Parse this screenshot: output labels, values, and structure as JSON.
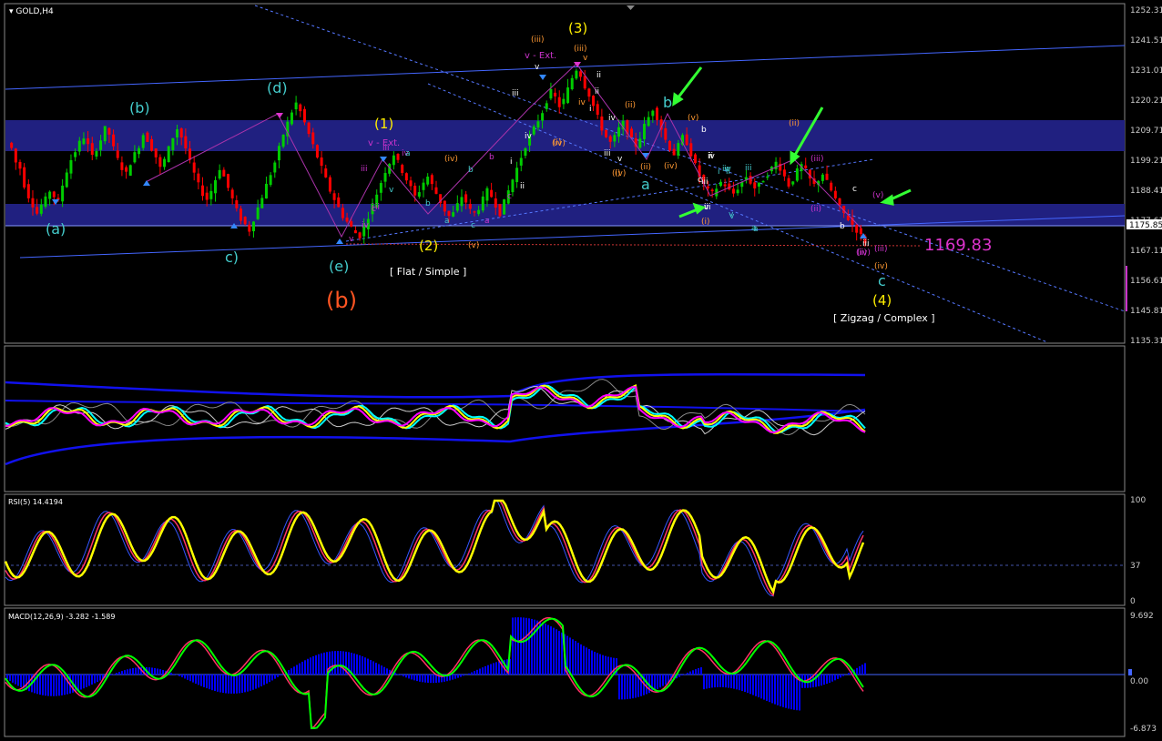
{
  "window": {
    "title": "GOLD,H4"
  },
  "price_panel": {
    "scale_labels": [
      "1252.31",
      "1241.51",
      "1231.01",
      "1220.21",
      "1209.71",
      "1199.21",
      "1188.41",
      "1177.61",
      "1167.11",
      "1156.61",
      "1145.81",
      "1135.31"
    ],
    "current_price": "1175.85",
    "target_price": "1169.83",
    "pattern_labels": [
      "[ Flat / Simple ]",
      "[ Zigzag / Complex ]"
    ],
    "wave_labels": {
      "a_b_c_d_e": [
        "(a)",
        "(b)",
        "c)",
        "(d)",
        "(e)"
      ],
      "big_b": "(b)",
      "yellow": [
        "(1)",
        "(2)",
        "(3)",
        "(4)"
      ],
      "cyan_abc": [
        "a",
        "b",
        "c"
      ],
      "ext": [
        "v - Ext.",
        "v - Ext."
      ],
      "small": [
        "iii",
        "iv",
        "v",
        "i",
        "ii",
        "iii",
        "iv",
        "v",
        "a",
        "b",
        "c",
        "a",
        "b",
        "c",
        "i",
        "ii",
        "iii",
        "iv",
        "v",
        "a",
        "b",
        "c",
        "ii",
        "iii",
        "iv",
        "v",
        "i",
        "ii",
        "iii",
        "iv",
        "v",
        "i",
        "ii",
        "iii",
        "iv",
        "v",
        "a",
        "b",
        "c",
        "iii",
        "iv",
        "v",
        "a",
        "b",
        "c",
        "ii",
        "iii",
        "iv",
        "v",
        "(i)",
        "(ii)",
        "(iii)",
        "(iv)",
        "(v)",
        "(i)",
        "(ii)",
        "(iii)",
        "(iv)",
        "(v)",
        "(i)",
        "(ii)",
        "(iii)",
        "(iv)",
        "(v)",
        "(ii)",
        "(iv)",
        "(ii)",
        "(iii)",
        "(iv)",
        "(v)"
      ]
    }
  },
  "bands_panel": {},
  "rsi_panel": {
    "title": "RSI(5) 14.4194",
    "scale_labels": [
      "100",
      "37",
      "0"
    ]
  },
  "macd_panel": {
    "title": "MACD(12,26,9) -3.282 -1.589",
    "scale_labels": [
      "9.692",
      "0.00",
      "-6.873"
    ]
  },
  "colors": {
    "background": "#000000",
    "bull_candle": "#00cc00",
    "bear_candle": "#ff0000",
    "zone": "#202080",
    "trendline": "#4466ff",
    "target_line": "#cc3333",
    "wave_yellow": "#ffee00",
    "wave_cyan": "#44cccc",
    "wave_orange": "#ff5522",
    "wave_magenta": "#cc33cc",
    "arrow_green": "#33ff33",
    "rsi_line": "#ffff00",
    "macd_line": "#00ff00",
    "macd_hist": "#0000ff"
  },
  "chart_data": [
    {
      "type": "candlestick",
      "title": "GOLD,H4",
      "ylim": [
        1135.31,
        1252.31
      ],
      "close_path": [
        1205,
        1203,
        1198,
        1196,
        1190,
        1186,
        1183,
        1180,
        1183,
        1185,
        1188,
        1186,
        1184,
        1190,
        1195,
        1199,
        1202,
        1205,
        1207,
        1204,
        1200,
        1203,
        1206,
        1210,
        1208,
        1203,
        1199,
        1196,
        1194,
        1198,
        1201,
        1204,
        1208,
        1206,
        1203,
        1200,
        1196,
        1199,
        1203,
        1207,
        1210,
        1207,
        1203,
        1198,
        1194,
        1190,
        1187,
        1185,
        1188,
        1192,
        1196,
        1193,
        1189,
        1185,
        1181,
        1178,
        1176,
        1174,
        1178,
        1182,
        1186,
        1190,
        1194,
        1198,
        1203,
        1208,
        1212,
        1216,
        1219,
        1216,
        1212,
        1208,
        1204,
        1200,
        1196,
        1192,
        1188,
        1185,
        1182,
        1179,
        1177,
        1175,
        1173,
        1172,
        1175,
        1179,
        1183,
        1187,
        1191,
        1195,
        1198,
        1201,
        1198,
        1195,
        1192,
        1189,
        1186,
        1188,
        1191,
        1193,
        1190,
        1187,
        1184,
        1181,
        1179,
        1180,
        1183,
        1186,
        1184,
        1181,
        1180,
        1182,
        1185,
        1188,
        1186,
        1183,
        1180,
        1184,
        1188,
        1192,
        1196,
        1200,
        1204,
        1207,
        1210,
        1213,
        1216,
        1220,
        1223,
        1221,
        1218,
        1220,
        1224,
        1228,
        1231,
        1229,
        1225,
        1222,
        1218,
        1214,
        1210,
        1207,
        1205,
        1207,
        1210,
        1212,
        1209,
        1206,
        1204,
        1207,
        1211,
        1214,
        1217,
        1214,
        1210,
        1206,
        1203,
        1201,
        1204,
        1207,
        1205,
        1201,
        1197,
        1193,
        1190,
        1188,
        1187,
        1189,
        1191,
        1190,
        1188,
        1187,
        1189,
        1191,
        1193,
        1191,
        1189,
        1190,
        1192,
        1194,
        1196,
        1198,
        1196,
        1193,
        1190,
        1192,
        1195,
        1197,
        1195,
        1192,
        1190,
        1192,
        1194,
        1191,
        1188,
        1185,
        1182,
        1180,
        1178,
        1176,
        1174,
        1172,
        1170
      ]
    },
    {
      "type": "line",
      "title": "RSI(5) 14.4194",
      "ylim": [
        0,
        100
      ],
      "levels": [
        37
      ],
      "series": [
        {
          "name": "RSI(5)",
          "current": 14.4194
        }
      ]
    },
    {
      "type": "bar",
      "title": "MACD(12,26,9) -3.282 -1.589",
      "ylim": [
        -6.873,
        9.692
      ],
      "series": [
        {
          "name": "MACD",
          "current": -3.282
        },
        {
          "name": "Signal",
          "current": -1.589
        }
      ]
    }
  ]
}
